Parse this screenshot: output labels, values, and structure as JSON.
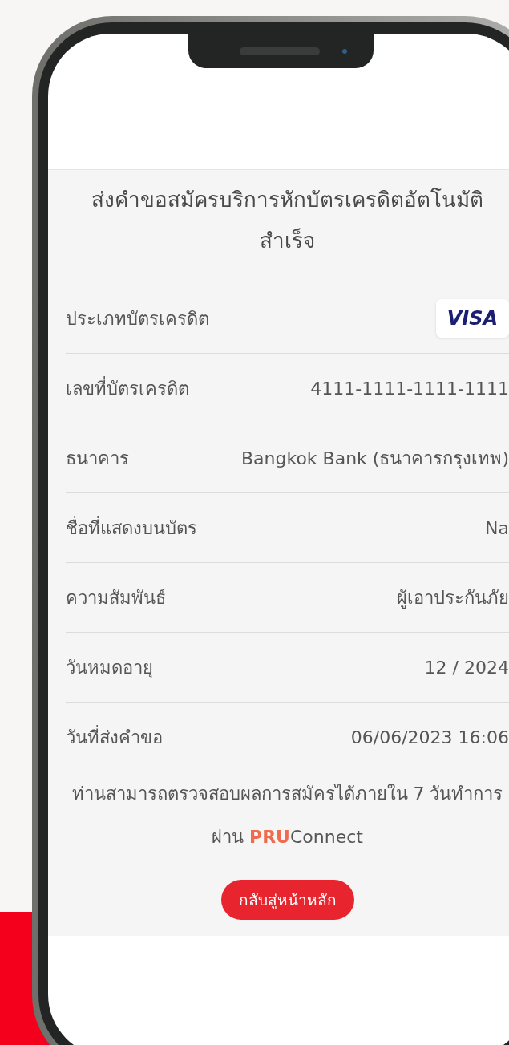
{
  "screen": {
    "title": "ส่งคำขอสมัครบริการหักบัตรเครดิตอัตโนมัติสำเร็จ",
    "details": [
      {
        "label": "ประเภทบัตรเครดิต",
        "value": "VISA",
        "kind": "card_logo"
      },
      {
        "label": "เลขที่บัตรเครดิต",
        "value": "4111-1111-1111-1111",
        "kind": "text"
      },
      {
        "label": "ธนาคาร",
        "value": "Bangkok Bank (ธนาคารกรุงเทพ)",
        "kind": "text"
      },
      {
        "label": "ชื่อที่แสดงบนบัตร",
        "value": "Na",
        "kind": "text"
      },
      {
        "label": "ความสัมพันธ์",
        "value": "ผู้เอาประกันภัย",
        "kind": "text"
      },
      {
        "label": "วันหมดอายุ",
        "value": "12 / 2024",
        "kind": "text"
      },
      {
        "label": "วันที่ส่งคำขอ",
        "value": "06/06/2023 16:06",
        "kind": "text"
      }
    ],
    "message": [
      "ท่านสามารถตรวจสอบผลการสมัครได้ภายใน 7 วันทำการ",
      "ผ่าน **PRU**Connect"
    ],
    "button": "กลับสู่หน้าหลัก"
  }
}
